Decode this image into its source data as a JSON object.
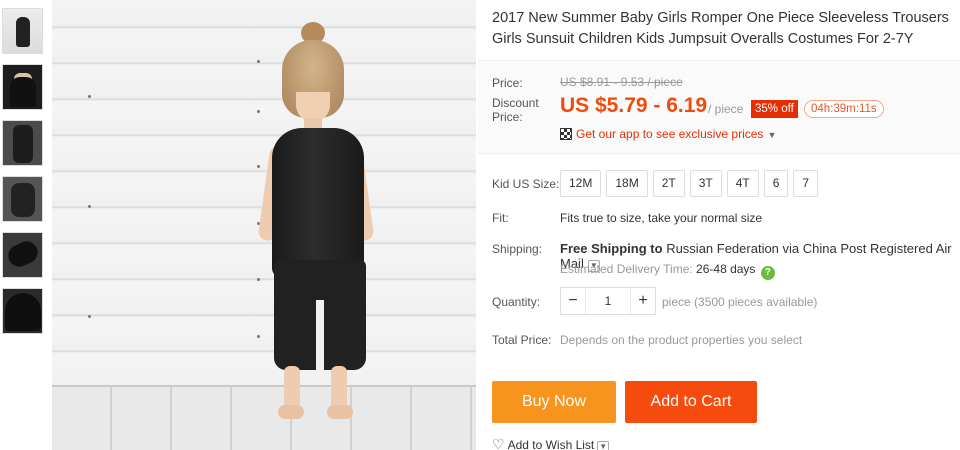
{
  "product": {
    "title": "2017 New Summer Baby Girls Romper One Piece Sleeveless Trousers Girls Sunsuit Children Kids Jumpsuit Overalls Costumes For 2-7Y",
    "thumbnails_count": 6
  },
  "pricing": {
    "price_label": "Price:",
    "original_price": "US $8.91 - 9.53 / piece",
    "discount_label": "Discount Price:",
    "discount_price": "US $5.79 - 6.19",
    "unit": "/ piece",
    "off_badge": "35% off",
    "timer": "04h:39m:11s",
    "app_link": "Get our app to see exclusive prices",
    "colors": {
      "price": "#f04b0c",
      "badge": "#e62e04"
    }
  },
  "options": {
    "size_label": "Kid US Size:",
    "sizes": [
      "12M",
      "18M",
      "2T",
      "3T",
      "4T",
      "6",
      "7"
    ],
    "fit_label": "Fit:",
    "fit_value": "Fits true to size, take your normal size"
  },
  "shipping": {
    "label": "Shipping:",
    "free_text": "Free Shipping to",
    "destination": "Russian Federation via China Post Registered Air Mail",
    "delivery_label": "Estimated Delivery Time:",
    "delivery_days": "26-48 days",
    "help_icon": "question-icon"
  },
  "quantity": {
    "label": "Quantity:",
    "value": "1",
    "availability": "piece (3500 pieces available)"
  },
  "total": {
    "label": "Total Price:",
    "value": "Depends on the product properties you select"
  },
  "actions": {
    "buy_now": "Buy Now",
    "add_to_cart": "Add to Cart",
    "wishlist": "Add to Wish List",
    "colors": {
      "buy_now": "#f7941d",
      "add_to_cart": "#f54b0f"
    }
  }
}
